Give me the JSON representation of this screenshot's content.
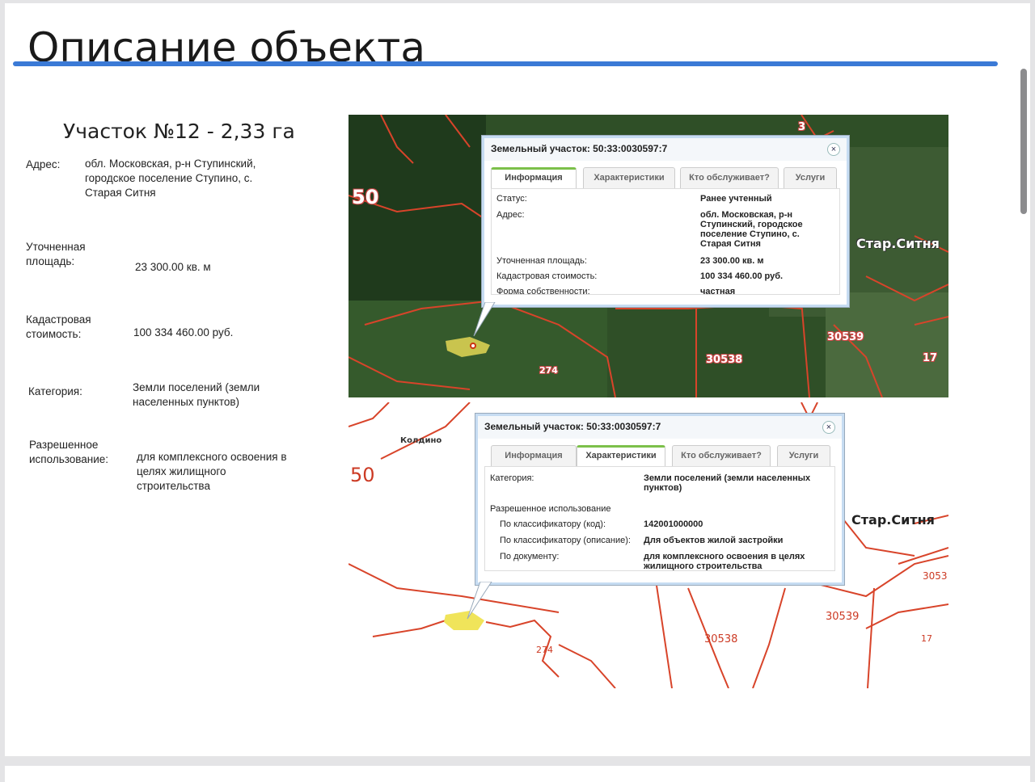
{
  "header": {
    "title": "Описание объекта"
  },
  "plot": {
    "title": "Участок №12 - 2,33 га",
    "address_label": "Адрес:",
    "address_value": "обл. Московская, р-н Ступинский, городское поселение Ступино, с. Старая Ситня",
    "area_label": "Уточненная площадь:",
    "area_value": "23 300.00 кв. м",
    "cost_label": "Кадастровая стоимость:",
    "cost_value": "100 334 460.00 руб.",
    "category_label": "Категория:",
    "category_value": "Земли поселений (земли населенных пунктов)",
    "use_label": "Разрешенное использование:",
    "use_value": "для комплексного освоения в целях жилищного строительства"
  },
  "map_satellite": {
    "labels": {
      "zone50": "50",
      "star_sitnya": "Стар.Ситня",
      "n30539": "30539",
      "n30538": "30538",
      "n274": "274",
      "n17": "17",
      "n3": "3"
    },
    "popup": {
      "title": "Земельный участок: 50:33:0030597:7",
      "close": "×",
      "tabs": [
        "Информация",
        "Характеристики",
        "Кто обслуживает?",
        "Услуги"
      ],
      "active_tab": "Информация",
      "rows": [
        {
          "label": "Статус:",
          "value": "Ранее учтенный"
        },
        {
          "label": "Адрес:",
          "value": "обл. Московская, р-н Ступинский, городское поселение Ступино, с. Старая Ситня"
        },
        {
          "label": "Уточненная площадь:",
          "value": "23 300.00 кв. м"
        },
        {
          "label": "Кадастровая стоимость:",
          "value": "100 334 460.00 руб."
        },
        {
          "label": "Форма собственности:",
          "value": "частная"
        }
      ]
    }
  },
  "map_vector": {
    "labels": {
      "zone50": "50",
      "star_sitnya": "Стар.Ситня",
      "n30539": "30539",
      "n30538": "30538",
      "n274": "274",
      "n17": "17",
      "n3053": "3053",
      "koldino": "Колдино"
    },
    "popup": {
      "title": "Земельный участок: 50:33:0030597:7",
      "close": "×",
      "tabs": [
        "Информация",
        "Характеристики",
        "Кто обслуживает?",
        "Услуги"
      ],
      "active_tab": "Характеристики",
      "category_label": "Категория:",
      "category_value": "Земли поселений (земли населенных пунктов)",
      "permitted_use_header": "Разрешенное использование",
      "class_code_label": "По классификатору (код):",
      "class_code_value": "142001000000",
      "class_desc_label": "По классификатору (описание):",
      "class_desc_value": "Для объектов жилой застройки",
      "doc_label": "По документу:",
      "doc_value": "для комплексного освоения в целях жилищного строительства"
    }
  },
  "colors": {
    "accent_rule": "#3b7ad6",
    "cadastre_line": "#d8442a",
    "parcel_fill": "#e8e05a",
    "tab_active": "#7cc04a"
  }
}
